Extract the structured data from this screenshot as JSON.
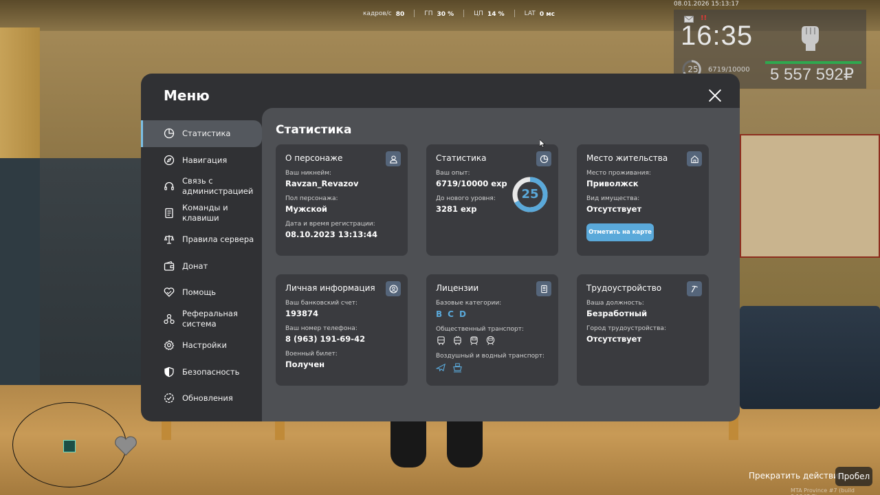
{
  "hud": {
    "perf": {
      "fps_label": "кадров/с",
      "fps_value": "80",
      "gpu_label": "ГП",
      "gpu_value": "30 %",
      "cpu_label": "ЦП",
      "cpu_value": "14 %",
      "lat_label": "LAT",
      "lat_value": "0 мс"
    },
    "datetime": "08.01.2026 15:13:17",
    "notif_count": "!!",
    "clock": "16:35",
    "level": "25",
    "xp": "6719/10000",
    "money": "5 557 592₽",
    "hp_color": "#2fa84f"
  },
  "menu": {
    "title": "Меню",
    "close_icon": "close-icon",
    "nav": [
      {
        "label": "Статистика",
        "icon": "pie-chart-icon",
        "active": true
      },
      {
        "label": "Навигация",
        "icon": "compass-icon"
      },
      {
        "label": "Связь с\nадминистрацией",
        "icon": "headset-icon"
      },
      {
        "label": "Команды и\nклавиши",
        "icon": "document-icon"
      },
      {
        "label": "Правила сервера",
        "icon": "scales-icon"
      },
      {
        "label": "Донат",
        "icon": "wallet-icon"
      },
      {
        "label": "Помощь",
        "icon": "handshake-heart-icon"
      },
      {
        "label": "Реферальная\nсистема",
        "icon": "referral-icon"
      },
      {
        "label": "Настройки",
        "icon": "gear-icon"
      },
      {
        "label": "Безопасность",
        "icon": "shield-icon"
      },
      {
        "label": "Обновления",
        "icon": "check-badge-icon"
      }
    ]
  },
  "content": {
    "title": "Статистика",
    "character": {
      "title": "О персонаже",
      "nick_label": "Ваш никнейм:",
      "nick": "Ravzan_Revazov",
      "gender_label": "Пол персонажа:",
      "gender": "Мужской",
      "reg_label": "Дата и время регистрации:",
      "reg": "08.10.2023 13:13:44"
    },
    "stats": {
      "title": "Статистика",
      "exp_label": "Ваш опыт:",
      "exp": "6719/10000 exp",
      "next_label": "До нового уровня:",
      "next": "3281 exp",
      "level": "25",
      "progress": 0.6719
    },
    "residence": {
      "title": "Место жительства",
      "place_label": "Место проживания:",
      "place": "Приволжск",
      "property_label": "Вид имущества:",
      "property": "Отсутствует",
      "map_button": "Отметить на карте"
    },
    "personal": {
      "title": "Личная информация",
      "bank_label": "Ваш банковский счет:",
      "bank": "193874",
      "phone_label": "Ваш номер телефона:",
      "phone": "8 (963) 191-69-42",
      "military_label": "Военный билет:",
      "military": "Получен"
    },
    "licenses": {
      "title": "Лицензии",
      "base_label": "Базовые категории:",
      "base": [
        "B",
        "C",
        "D"
      ],
      "public_label": "Общественный транспорт:",
      "public_icons": [
        "bus-icon",
        "trolleybus-icon",
        "train-icon",
        "tram-icon"
      ],
      "air_label": "Воздушный и водный транспорт:",
      "air_icons": [
        "plane-icon",
        "boat-icon"
      ]
    },
    "job": {
      "title": "Трудоустройство",
      "position_label": "Ваша должность:",
      "position": "Безработный",
      "city_label": "Город трудоустройства:",
      "city": "Отсутствует"
    }
  },
  "bottom": {
    "cancel_action": "Прекратить действие",
    "key": "Пробел",
    "build": "MTA Province #7 (build 8.1247.7)"
  },
  "accent": "#5aa9da"
}
